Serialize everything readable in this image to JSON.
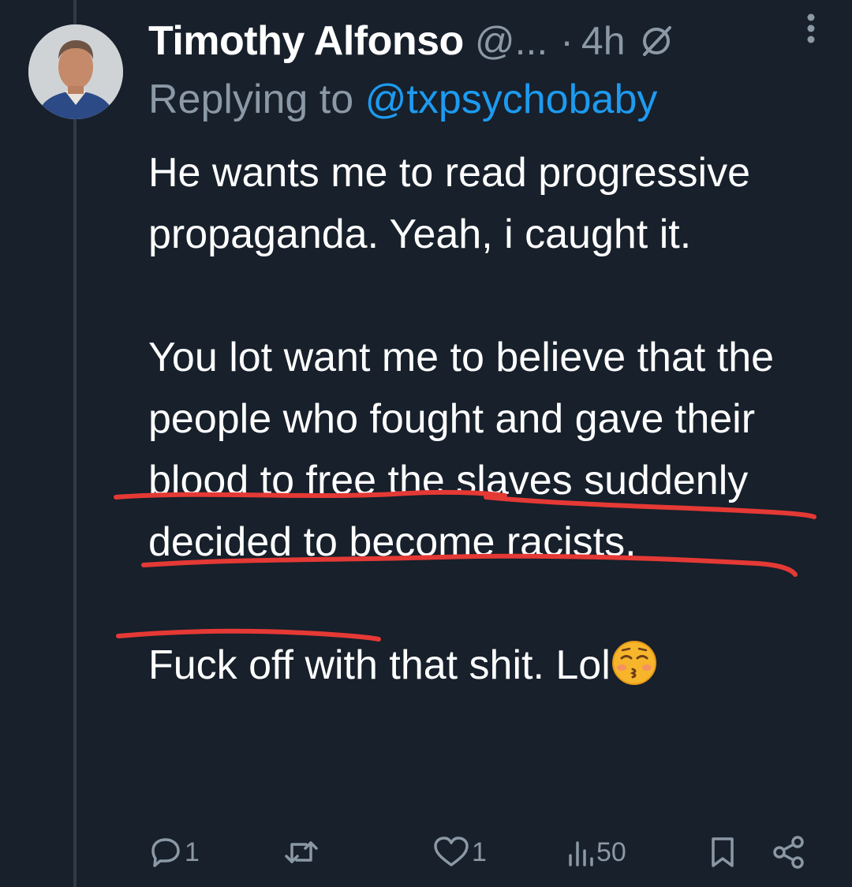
{
  "tweet": {
    "author_name": "Timothy Alfonso",
    "handle": "@...",
    "separator": "·",
    "time": "4h",
    "replying_prefix": "Replying to ",
    "replying_to": "@txpsychobaby",
    "paragraphs": [
      "He wants me to read progressive propaganda. Yeah, i caught it.",
      "You lot want me to believe that the people who fought and gave their blood to free the slaves suddenly decided to become racists.",
      "Fuck off with that shit.  Lol"
    ],
    "emoji": "kissing-face-with-closed-eyes",
    "annotation_color": "#e53935"
  },
  "actions": {
    "replies": "1",
    "retweets": "",
    "likes": "1",
    "views": "50"
  },
  "colors": {
    "background": "#17202b",
    "secondary_text": "#8b98a5",
    "link": "#1d9bf0"
  }
}
